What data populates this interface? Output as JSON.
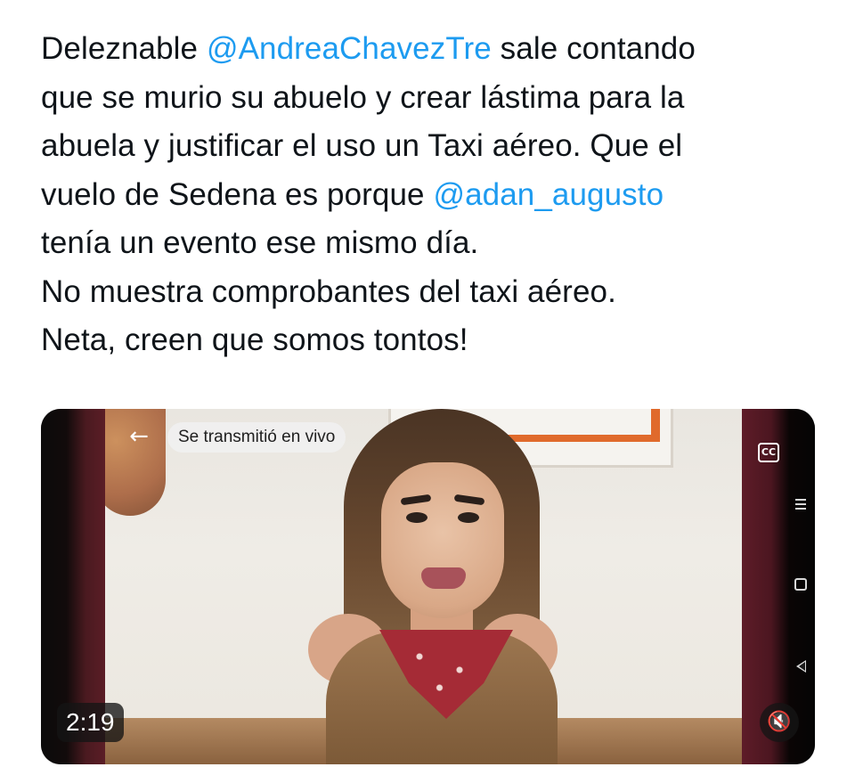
{
  "tweet": {
    "lines": [
      {
        "before": "Deleznable ",
        "mention": "@AndreaChavezTre",
        "after": " sale contando"
      },
      {
        "text": "que se murio su abuelo y crear lástima para la"
      },
      {
        "text": "abuela y justificar el uso un Taxi aéreo. Que el"
      },
      {
        "before": "vuelo de Sedena es porque ",
        "mention": "@adan_augusto",
        "after": ""
      },
      {
        "text": "tenía un evento ese mismo día."
      },
      {
        "text": "No muestra comprobantes del taxi aéreo."
      },
      {
        "text": "Neta, creen que somos tontos!"
      }
    ],
    "mention_color": "#1d9bf0",
    "text_color": "#0f1419"
  },
  "video": {
    "overlay_label": "Se transmitió en vivo",
    "duration": "2:19",
    "icons": {
      "back": "back-arrow-icon",
      "captions": "closed-captions-icon",
      "mute": "volume-muted-icon",
      "nav_menu": "recent-apps-icon",
      "nav_home": "home-icon",
      "nav_back": "nav-back-icon"
    },
    "back_glyph": "←",
    "captions_glyph": "CC",
    "mute_glyph": "🔇"
  }
}
